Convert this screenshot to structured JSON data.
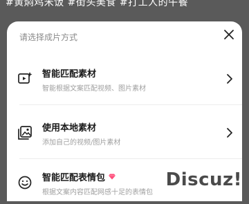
{
  "background": {
    "hashtags": "#黄焖鸡米饭 #街头美食 #打工人的午餐"
  },
  "sheet": {
    "title": "请选择成片方式",
    "options": [
      {
        "label": "智能匹配素材",
        "description": "智能根据文案匹配视频、图片素材",
        "icon": "smart-play-icon"
      },
      {
        "label": "使用本地素材",
        "description": "添加自己的视频/图片素材",
        "icon": "local-media-icon"
      },
      {
        "label": "智能匹配表情包",
        "description": "根据文案内容匹配网感十足的表情包",
        "icon": "smiley-icon",
        "badge": "gem-icon"
      }
    ]
  },
  "watermark": {
    "text": "Discuz!"
  },
  "colors": {
    "sheet": "#ffffff",
    "title": "#8a8a8a",
    "label": "#1a1a1a",
    "desc": "#a0a0a0",
    "gem": "#ff4d7a"
  }
}
